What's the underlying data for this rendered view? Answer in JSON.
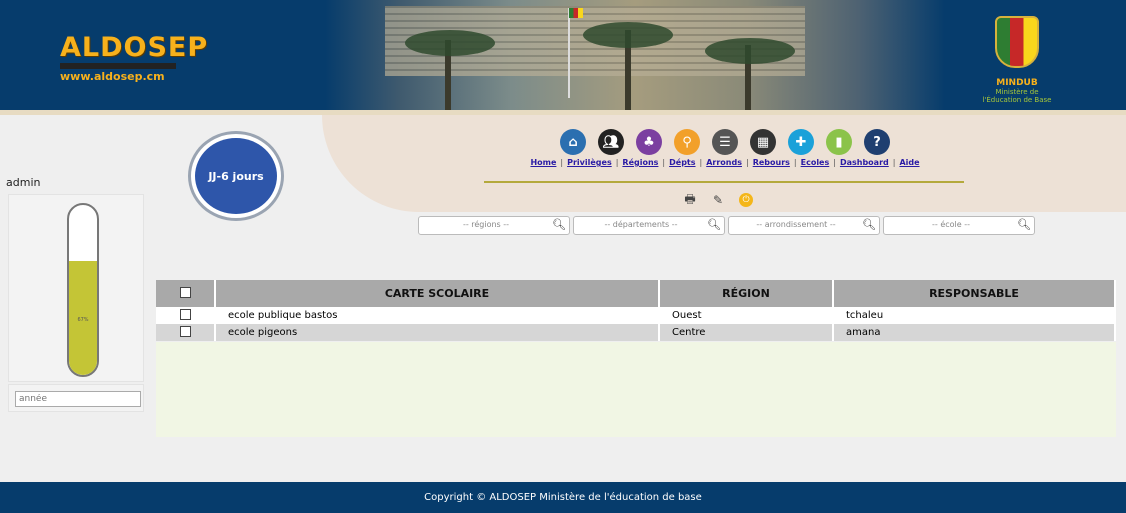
{
  "header": {
    "logo_title": "ALDOSEP",
    "logo_url": "www.aldosep.cm",
    "ministry_short": "MINDUB",
    "ministry_long": "Ministère de l'Éducation de Base"
  },
  "timer": {
    "label": "JJ-6 jours"
  },
  "sidebar": {
    "username": "admin",
    "gauge_percent": 67,
    "gauge_label": "67%",
    "year_placeholder": "année"
  },
  "nav": {
    "items": [
      {
        "label": "Home",
        "icon": "home-icon",
        "color": "#2b6fb0"
      },
      {
        "label": "Privilèges",
        "icon": "users-icon",
        "color": "#222222"
      },
      {
        "label": "Régions",
        "icon": "map-icon",
        "color": "#7b3fa0"
      },
      {
        "label": "Dépts",
        "icon": "location-pin-icon",
        "color": "#f2a02a"
      },
      {
        "label": "Arronds",
        "icon": "document-icon",
        "color": "#555555"
      },
      {
        "label": "Rebours",
        "icon": "calendar-icon",
        "color": "#333333"
      },
      {
        "label": "Ecoles",
        "icon": "graduation-cap-icon",
        "color": "#1ba1d9"
      },
      {
        "label": "Dashboard",
        "icon": "chart-icon",
        "color": "#8bc34a"
      },
      {
        "label": "Aide",
        "icon": "help-icon",
        "color": "#1f3f70"
      }
    ]
  },
  "search": {
    "regions_placeholder": "-- régions --",
    "departements_placeholder": "-- départements --",
    "arrondissement_placeholder": "-- arrondissement --",
    "ecole_placeholder": "-- école --"
  },
  "table": {
    "headers": [
      "CARTE SCOLAIRE",
      "RÉGION",
      "RESPONSABLE"
    ],
    "rows": [
      [
        "ecole publique bastos",
        "Ouest",
        "tchaleu"
      ],
      [
        "ecole pigeons",
        "Centre",
        "amana"
      ]
    ]
  },
  "footer": {
    "text": "Copyright © ALDOSEP Ministère de l'éducation de base"
  }
}
